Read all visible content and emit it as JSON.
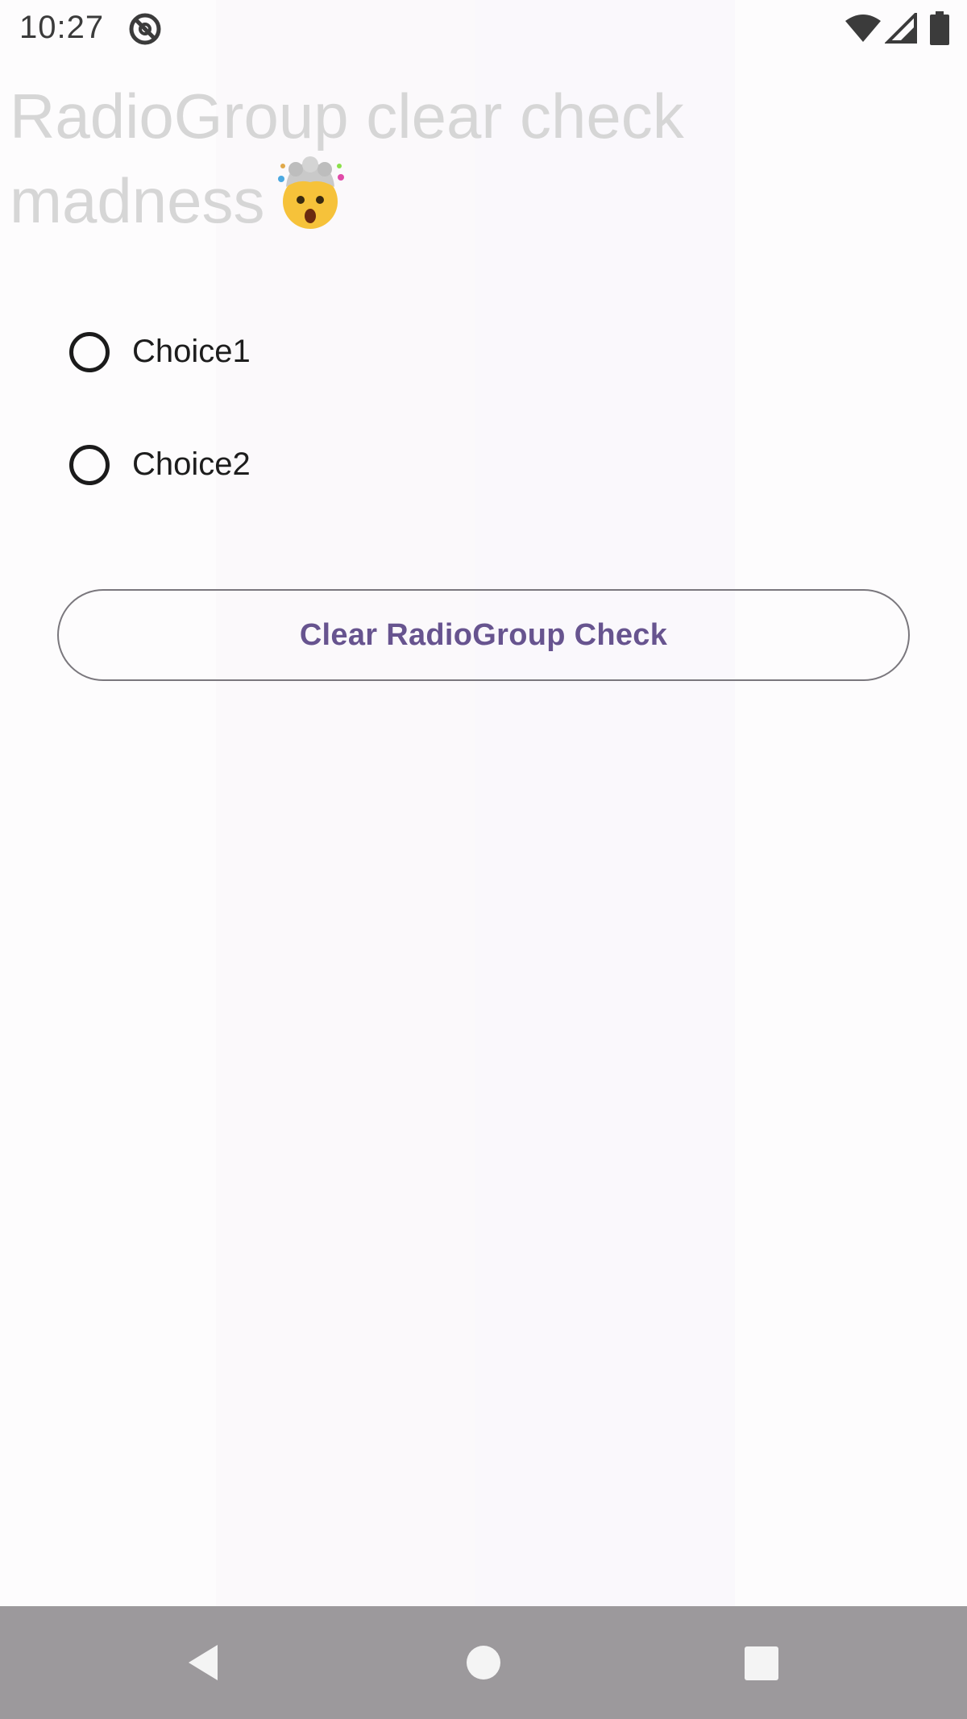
{
  "status_bar": {
    "time": "10:27",
    "icons": [
      "sync-icon",
      "wifi-icon",
      "signal-icon",
      "battery-icon"
    ]
  },
  "screen": {
    "title": "RadioGroup clear check madness",
    "title_emoji_icon": "exploding-head-emoji-icon"
  },
  "radio_group": {
    "options": [
      {
        "label": "Choice1",
        "checked": false
      },
      {
        "label": "Choice2",
        "checked": false
      }
    ]
  },
  "clear_button": {
    "label": "Clear RadioGroup Check"
  },
  "nav_bar": {
    "buttons": [
      "back-icon",
      "home-icon",
      "recents-icon"
    ]
  },
  "colors": {
    "button_text": "#67548f",
    "button_outline": "#7a777d",
    "title_text": "#d6d6d6",
    "nav_bar": "#9c999c"
  }
}
